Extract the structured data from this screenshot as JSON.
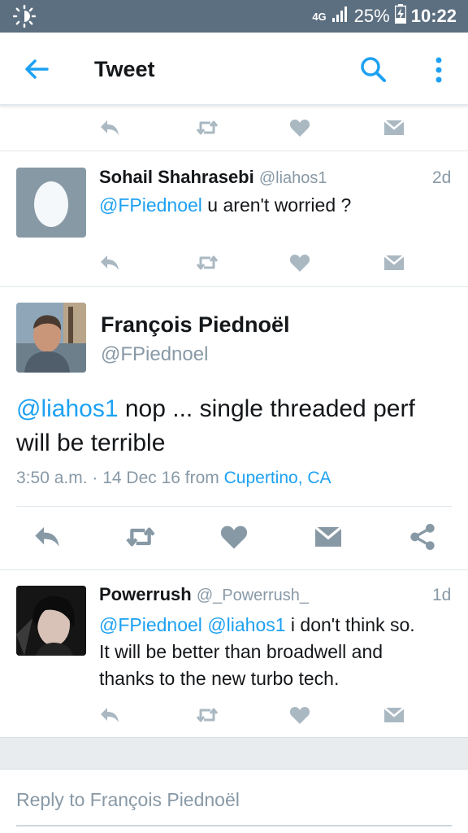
{
  "status_bar": {
    "network": "4G",
    "battery": "25%",
    "time": "10:22",
    "icons": [
      "brightness-icon",
      "signal-icon",
      "battery-charging-icon"
    ]
  },
  "app_bar": {
    "title": "Tweet",
    "icons": [
      "back-arrow-icon",
      "search-icon",
      "more-vert-icon"
    ]
  },
  "replies": [
    {
      "name": "Sohail Shahrasebi",
      "handle": "@liahos1",
      "time": "2d",
      "mention": "@FPiednoel",
      "text": " u aren't worried ?"
    },
    {
      "name": "Powerrush",
      "handle": "@_Powerrush_",
      "time": "1d",
      "mention1": "@FPiednoel",
      "mention2": "@liahos1",
      "text_line1": " i don't think so.",
      "text_line2": "It will be better than broadwell and",
      "text_line3": "thanks to the new turbo tech."
    }
  ],
  "main_tweet": {
    "name": "François Piednoël",
    "handle": "@FPiednoel",
    "mention": "@liahos1",
    "text_line1": " nop ... single threaded perf",
    "text_line2": "will be terrible",
    "timestamp": "3:50 a.m. · 14 Dec 16",
    "from_label": "from",
    "location": "Cupertino, CA"
  },
  "reply_box": {
    "placeholder": "Reply to François Piednoël"
  },
  "colors": {
    "accent": "#1da1f2",
    "icon_grey": "#aab8c2",
    "status_bar": "#5c6f80"
  }
}
